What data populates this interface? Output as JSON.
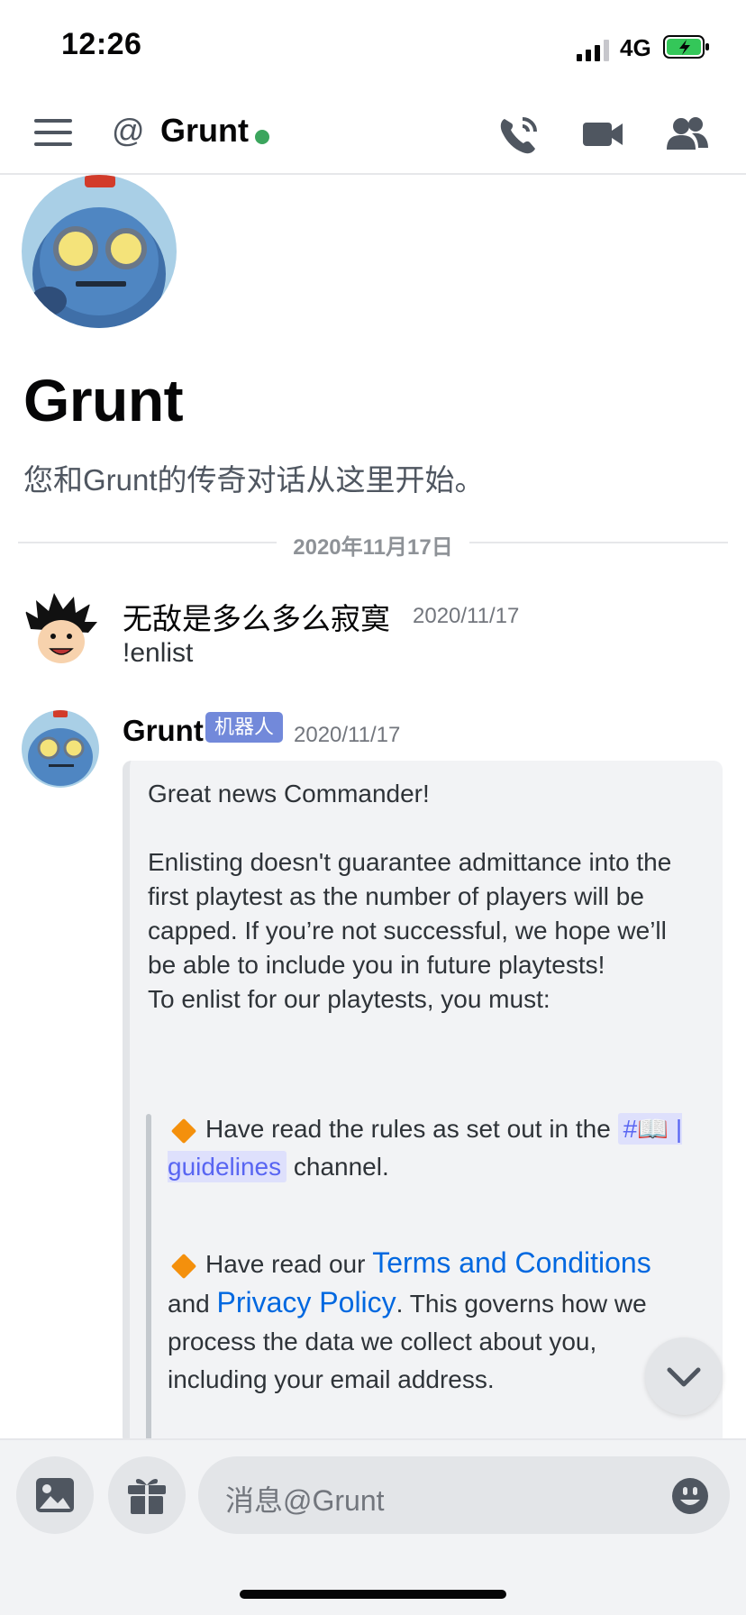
{
  "status": {
    "time": "12:26",
    "network": "4G"
  },
  "header": {
    "at_symbol": "@",
    "title": "Grunt"
  },
  "intro": {
    "name": "Grunt",
    "text": "您和Grunt的传奇对话从这里开始。"
  },
  "divider": {
    "date": "2020年11月17日"
  },
  "messages": [
    {
      "author": "无敌是多么多么寂寞",
      "timestamp": "2020/11/17",
      "text": "!enlist"
    },
    {
      "author": "Grunt",
      "bot_tag": "机器人",
      "timestamp": "2020/11/17"
    }
  ],
  "embed": {
    "p1": "Great news Commander!",
    "p2": "Enlisting doesn't guarantee admittance into the first playtest as the number of players will be capped. If you’re not successful, we hope we’ll be able to include you in future playtests!",
    "p3": "To enlist for our playtests, you must:",
    "q1_pre": "Have read the rules as set out in the ",
    "q1_channel": "#📖 | guidelines",
    "q1_post": " channel.",
    "q2_pre": "Have read our ",
    "q2_link1": "Terms and Conditions",
    "q2_mid": " and ",
    "q2_link2": "Privacy Policy",
    "q2_post": ". This governs how we process the data we collect about you, including your email address."
  },
  "composer": {
    "placeholder": "消息@Grunt"
  },
  "colors": {
    "online": "#3ba55d",
    "bot_tag": "#7289da",
    "link": "#0068e0",
    "channel_mention": "#5865f2"
  }
}
